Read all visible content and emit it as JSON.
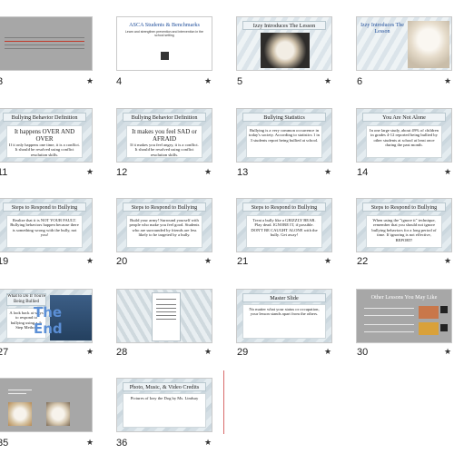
{
  "rows": [
    {
      "slides": [
        {
          "num": "3",
          "title": "",
          "body": ""
        },
        {
          "num": "4",
          "title": "ASCA Students & Benchmarks",
          "body": "Learn and strengthen prevention and intervention in the school setting"
        },
        {
          "num": "5",
          "title": "Izzy Introduces The Lesson",
          "body": ""
        },
        {
          "num": "6",
          "title": "Izzy Introduces The Lesson",
          "body": ""
        }
      ]
    },
    {
      "slides": [
        {
          "num": "11",
          "title": "Bullying Behavior Definition",
          "body_big": "It happens OVER AND OVER",
          "body": "If it only happens one time, it is a conflict. It should be resolved using conflict resolution skills."
        },
        {
          "num": "12",
          "title": "Bullying Behavior Definition",
          "body_big": "It makes you feel SAD or AFRAID",
          "body": "If it makes you feel angry, it is a conflict. It should be resolved using conflict resolution skills."
        },
        {
          "num": "13",
          "title": "Bullying Statistics",
          "body": "Bullying is a very common occurrence in today's society. According to statistics 1 in 3 students report being bullied at school."
        },
        {
          "num": "14",
          "title": "You Are Not Alone",
          "body": "In one large study, about 49% of children in grades 4-12 reported being bullied by other students at school at least once during the past month."
        }
      ]
    },
    {
      "slides": [
        {
          "num": "19",
          "title": "Steps to Respond to Bullying",
          "body": "Realize that it is NOT YOUR FAULT. Bullying behaviors happen because there is something wrong with the bully, not you!"
        },
        {
          "num": "20",
          "title": "Steps to Respond to Bullying",
          "body": "Build your army! Surround yourself with people who make you feel good. Students who are surrounded by friends are less likely to be targeted by a bully."
        },
        {
          "num": "21",
          "title": "Steps to Respond to Bullying",
          "body": "Treat a bully like a GRIZZLY BEAR. Play dead. IGNORE IT, if possible. DON'T BE CAUGHT ALONE with the bully. Get away!"
        },
        {
          "num": "22",
          "title": "Steps to Respond to Bullying",
          "body": "When using the \"ignore it\" technique, remember that you should not ignore bullying behaviors for a long period of time. If ignoring is not effective, REPORT!"
        }
      ]
    },
    {
      "slides": [
        {
          "num": "27",
          "title": "What to Do If You're Being Bullied",
          "body": "A look back at ways to respond to bullying using a 4-Step Method",
          "overlay": "The End"
        },
        {
          "num": "28",
          "title": "",
          "body": ""
        },
        {
          "num": "29",
          "title": "Master Slide",
          "body": "No matter what your status or occupation, your lesson stands apart from the others."
        },
        {
          "num": "30",
          "title": "Other Lessons You May Like",
          "body": ""
        }
      ]
    },
    {
      "slides": [
        {
          "num": "35",
          "title": "",
          "body": ""
        },
        {
          "num": "36",
          "title": "Photo, Music, & Video Credits",
          "body": "Pictures of Izzy the Dog by Ms. Lindsay"
        }
      ]
    }
  ],
  "star_glyph": "★"
}
